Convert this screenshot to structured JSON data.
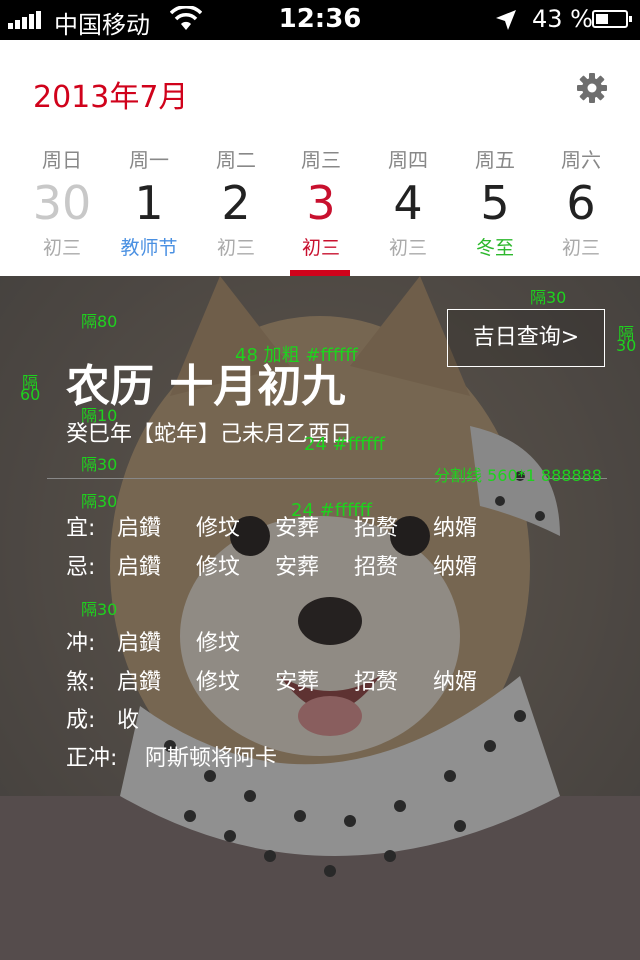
{
  "status_bar": {
    "carrier": "中国移动",
    "time": "12:36",
    "battery_percent": "43 %",
    "battery_level": 0.43
  },
  "calendar": {
    "month_title": "2013年7月",
    "days": [
      {
        "weekday": "周日",
        "number": "30",
        "sub": "初三"
      },
      {
        "weekday": "周一",
        "number": "1",
        "sub": "教师节"
      },
      {
        "weekday": "周二",
        "number": "2",
        "sub": "初三"
      },
      {
        "weekday": "周三",
        "number": "3",
        "sub": "初三"
      },
      {
        "weekday": "周四",
        "number": "4",
        "sub": "初三"
      },
      {
        "weekday": "周五",
        "number": "5",
        "sub": "冬至"
      },
      {
        "weekday": "周六",
        "number": "6",
        "sub": "初三"
      }
    ]
  },
  "detail": {
    "jiri_button": "吉日查询>",
    "lunar_title": "农历 十月初九",
    "ganzhi": "癸巳年【蛇年】己未月乙酉日",
    "yi": {
      "label": "宜:",
      "items": [
        "启鑽",
        "修坟",
        "安葬",
        "招赘",
        "纳婿"
      ]
    },
    "ji": {
      "label": "忌:",
      "items": [
        "启鑽",
        "修坟",
        "安葬",
        "招赘",
        "纳婿"
      ]
    },
    "chong": {
      "label": "冲:",
      "items": [
        "启鑽",
        "修坟"
      ]
    },
    "sha": {
      "label": "煞:",
      "items": [
        "启鑽",
        "修坟",
        "安葬",
        "招赘",
        "纳婿"
      ]
    },
    "cheng": {
      "label": "成:",
      "value": "收"
    },
    "zhengchong": {
      "label": "正冲:",
      "value": "阿斯顿将阿卡"
    }
  },
  "annotations": {
    "gap30_top": "隔30",
    "gap30_right_a": "隔",
    "gap30_right_b": "30",
    "gap80": "隔80",
    "gap60_a": "隔",
    "gap60_b": "60",
    "title_font": "48 加粗 #ffffff",
    "gap10": "隔10",
    "ganzhi_font": "24 #ffffff",
    "gap30_a": "隔30",
    "divider_note": "分割线  560*1 888888",
    "gap30_b": "隔30",
    "list_font": "24 #ffffff",
    "gap30_c": "隔30"
  },
  "colors": {
    "accent": "#d0021b",
    "holiday": "#4a90e2",
    "solar_term": "#2db82d",
    "annotation": "#1ed21e",
    "divider": "#888888"
  }
}
